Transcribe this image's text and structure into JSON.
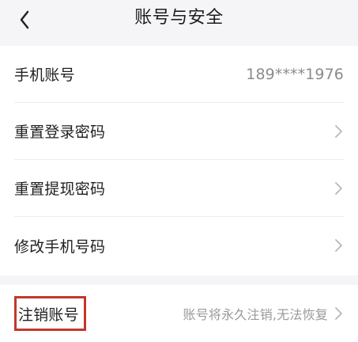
{
  "header": {
    "title": "账号与安全",
    "back_icon": "back-chevron-icon"
  },
  "settings": {
    "items": [
      {
        "label": "手机账号",
        "value": "189****1976",
        "chevron": false
      },
      {
        "label": "重置登录密码",
        "value": "",
        "chevron": true
      },
      {
        "label": "重置提现密码",
        "value": "",
        "chevron": true
      },
      {
        "label": "修改手机号码",
        "value": "",
        "chevron": true
      }
    ]
  },
  "account": {
    "cancel_label": "注销账号",
    "cancel_desc": "账号将永久注销,无法恢复"
  },
  "colors": {
    "highlight": "#c0392b"
  }
}
